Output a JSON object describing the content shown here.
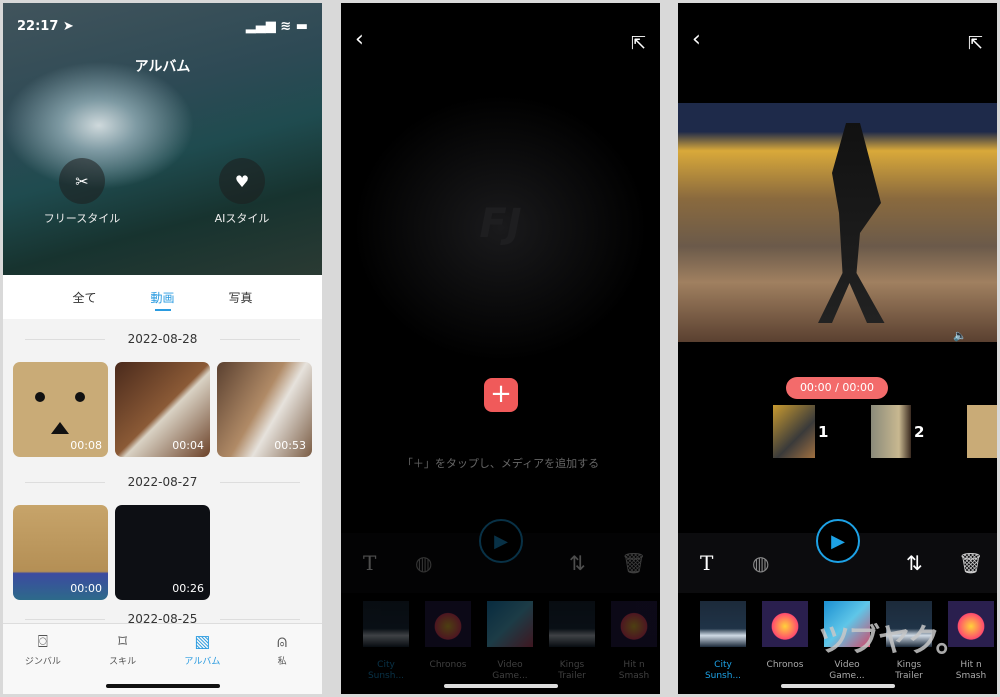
{
  "album": {
    "status": {
      "time": "22:17 ➤",
      "icons": "▂▄▆ ≋ ▬"
    },
    "title": "アルバム",
    "modes": [
      {
        "label": "フリースタイル",
        "icon": "✂"
      },
      {
        "label": "AIスタイル",
        "icon": "♥"
      }
    ],
    "tabs": [
      {
        "label": "全て"
      },
      {
        "label": "動画",
        "active": true
      },
      {
        "label": "写真"
      }
    ],
    "groups": [
      {
        "date": "2022-08-28",
        "videos": [
          {
            "duration": "00:08"
          },
          {
            "duration": "00:04"
          },
          {
            "duration": "00:53"
          }
        ]
      },
      {
        "date": "2022-08-27",
        "videos": [
          {
            "duration": "00:00"
          },
          {
            "duration": "00:26"
          }
        ]
      },
      {
        "date": "2022-08-25"
      }
    ],
    "tabbar": [
      {
        "label": "ジンバル",
        "icon": "gimbal"
      },
      {
        "label": "スキル",
        "icon": "bookmark"
      },
      {
        "label": "アルバム",
        "icon": "album",
        "active": true
      },
      {
        "label": "私",
        "icon": "person"
      }
    ]
  },
  "editor_empty": {
    "hint": "「＋」をタップし、メディアを追加する",
    "add_icon": "+",
    "logo": "FJ"
  },
  "editor": {
    "time": "00:00 / 00:00",
    "clips": [
      {
        "index": "1"
      },
      {
        "index": "2"
      }
    ],
    "watermark": "ツブヤク。"
  },
  "music": [
    {
      "name": "City Sunsh..."
    },
    {
      "name": "Chronos"
    },
    {
      "name": "Video Game..."
    },
    {
      "name": "Kings Trailer"
    },
    {
      "name": "Hit n Smash"
    }
  ],
  "colors": {
    "accent": "#2a9be0",
    "add_button": "#f05a5a",
    "time_pill": "#f36b6b"
  }
}
